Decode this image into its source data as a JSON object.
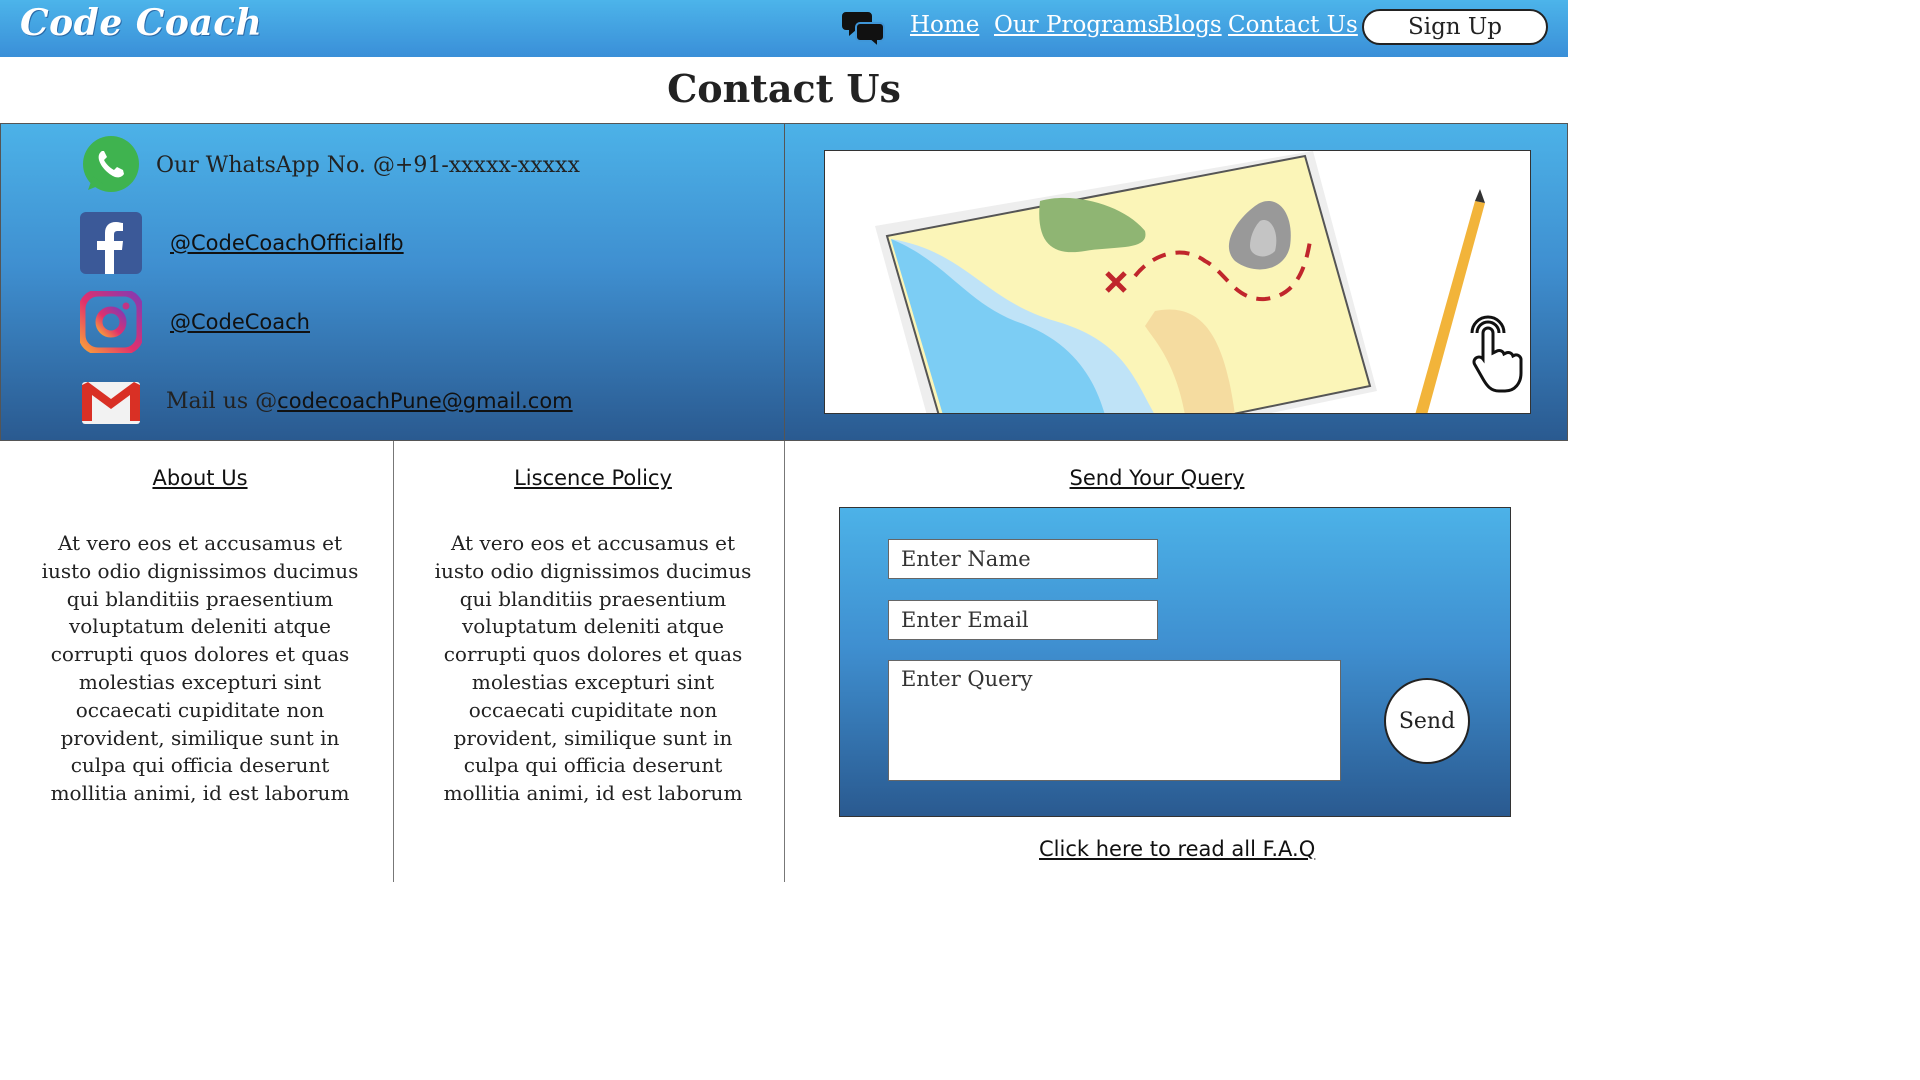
{
  "header": {
    "logo": "Code Coach",
    "nav": [
      "Home",
      "Our Programs",
      "Blogs",
      "Contact Us"
    ],
    "signup_label": "Sign Up"
  },
  "page": {
    "title": "Contact Us"
  },
  "contact": {
    "whatsapp_text": "Our WhatsApp No. @+91-xxxxx-xxxxx",
    "facebook_handle": "@CodeCoachOfficialfb",
    "instagram_handle": "@CodeCoach",
    "mail_prefix": "Mail us @",
    "mail_address": "codecoachPune@gmail.com"
  },
  "about": {
    "title": "About Us",
    "text": "At vero eos et accusamus et iusto odio dignissimos ducimus qui blanditiis praesentium voluptatum deleniti atque corrupti quos dolores et quas molestias excepturi sint occaecati cupiditate non provident, similique sunt in culpa qui officia deserunt mollitia animi, id est laborum"
  },
  "licence": {
    "title": "Liscence Policy",
    "text": "At vero eos et accusamus et iusto odio dignissimos ducimus qui blanditiis praesentium voluptatum deleniti atque corrupti quos dolores et quas molestias excepturi sint occaecati cupiditate non provident, similique sunt in culpa qui officia deserunt mollitia animi, id est laborum"
  },
  "query": {
    "title": "Send Your Query",
    "name_placeholder": "Enter Name",
    "email_placeholder": "Enter Email",
    "query_placeholder": "Enter Query",
    "send_label": "Send",
    "faq_link": "Click here to read all F.A.Q"
  },
  "colors": {
    "gradient_top": "#4cb2e8",
    "gradient_bottom": "#2a5a90",
    "whatsapp": "#3fb34f",
    "facebook": "#3b5998",
    "gmail_red": "#d93025"
  }
}
